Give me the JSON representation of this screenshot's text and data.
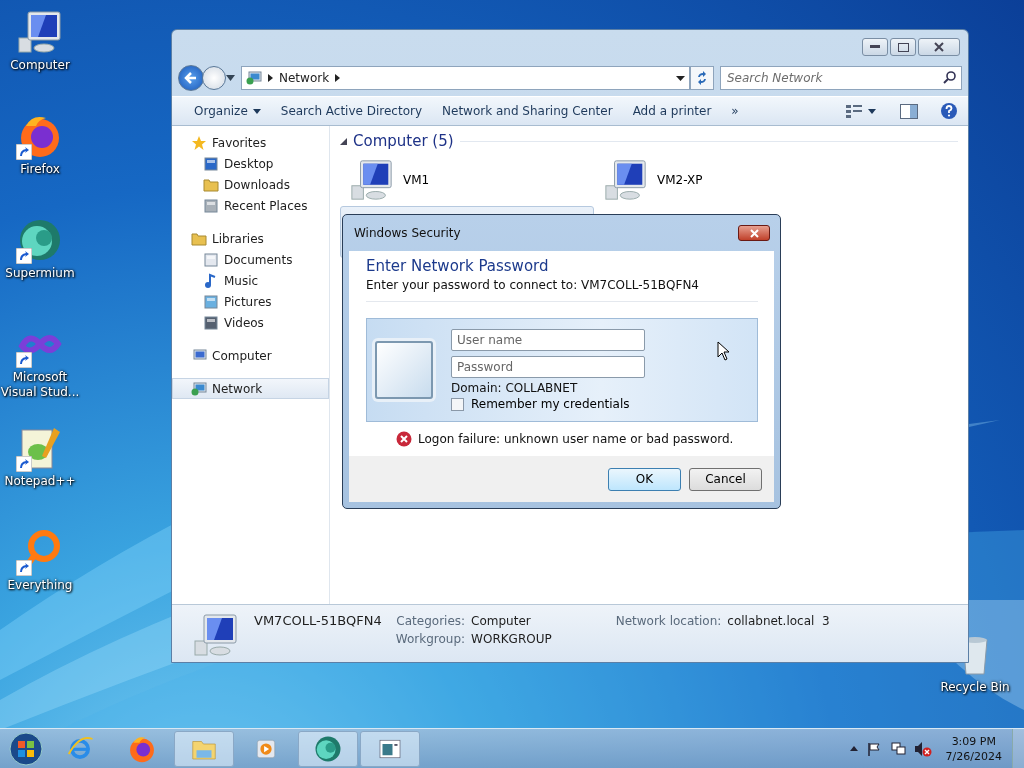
{
  "desktop_icons": [
    {
      "label": "Computer",
      "kind": "computer",
      "shortcut": false
    },
    {
      "label": "Firefox",
      "kind": "firefox",
      "shortcut": true
    },
    {
      "label": "Supermium",
      "kind": "supermium",
      "shortcut": true
    },
    {
      "label": "Microsoft Visual Stud...",
      "kind": "studio",
      "shortcut": true
    },
    {
      "label": "Notepad++",
      "kind": "notepad",
      "shortcut": true
    },
    {
      "label": "Everything",
      "kind": "everything",
      "shortcut": true
    },
    {
      "label": "Recycle Bin",
      "kind": "bin",
      "shortcut": false
    }
  ],
  "explorer": {
    "address": {
      "path": "Network"
    },
    "search": {
      "placeholder": "Search Network"
    },
    "commands": [
      {
        "label": "Organize",
        "dropdown": true
      },
      {
        "label": "Search Active Directory",
        "dropdown": false
      },
      {
        "label": "Network and Sharing Center",
        "dropdown": false
      },
      {
        "label": "Add a printer",
        "dropdown": false
      },
      {
        "label": "»",
        "dropdown": false
      }
    ],
    "nav": [
      {
        "label": "Favorites",
        "kind": "star",
        "selected": false,
        "children": [
          {
            "label": "Desktop",
            "kind": "desktop",
            "selected": false
          },
          {
            "label": "Downloads",
            "kind": "folder",
            "selected": false
          },
          {
            "label": "Recent Places",
            "kind": "recent",
            "selected": false
          }
        ]
      },
      {
        "label": "Libraries",
        "kind": "library",
        "selected": false,
        "children": [
          {
            "label": "Documents",
            "kind": "doc",
            "selected": false
          },
          {
            "label": "Music",
            "kind": "music",
            "selected": false
          },
          {
            "label": "Pictures",
            "kind": "pictures",
            "selected": false
          },
          {
            "label": "Videos",
            "kind": "videos",
            "selected": false
          }
        ]
      },
      {
        "label": "Computer",
        "kind": "computer",
        "selected": false
      },
      {
        "label": "Network",
        "kind": "network",
        "selected": true
      }
    ],
    "group": {
      "title": "Computer (5)",
      "expanded": true,
      "items": [
        {
          "label": "VM1",
          "selected": false
        },
        {
          "label": "VM2-XP",
          "selected": false
        },
        {
          "selected": true
        }
      ]
    },
    "details": {
      "name": "VM7COLL-51BQFN4",
      "fields": [
        {
          "label": "Categories:",
          "value": "Computer"
        },
        {
          "label": "Workgroup:",
          "value": "WORKGROUP"
        }
      ],
      "location": {
        "label": "Network location:",
        "value": "collabnet.local  3"
      }
    }
  },
  "dialog": {
    "title": "Windows Security",
    "heading": "Enter Network Password",
    "subtitle": "Enter your password to connect to: VM7COLL-51BQFN4",
    "username": {
      "placeholder": "User name"
    },
    "password": {
      "placeholder": "Password"
    },
    "domain": "Domain: COLLABNET",
    "remember": {
      "label": "Remember my credentials",
      "checked": false
    },
    "error": "Logon failure: unknown user name or bad password.",
    "buttons": [
      {
        "label": "OK",
        "default": true
      },
      {
        "label": "Cancel",
        "default": false
      }
    ]
  },
  "taskbar": {
    "apps": [
      {
        "kind": "ie",
        "open": false
      },
      {
        "kind": "firefox",
        "open": false
      },
      {
        "kind": "explorer",
        "open": true
      },
      {
        "kind": "media",
        "open": false
      },
      {
        "kind": "supermium",
        "open": true
      },
      {
        "kind": "window",
        "open": true
      }
    ],
    "time": "3:09 PM",
    "date": "7/26/2024"
  }
}
